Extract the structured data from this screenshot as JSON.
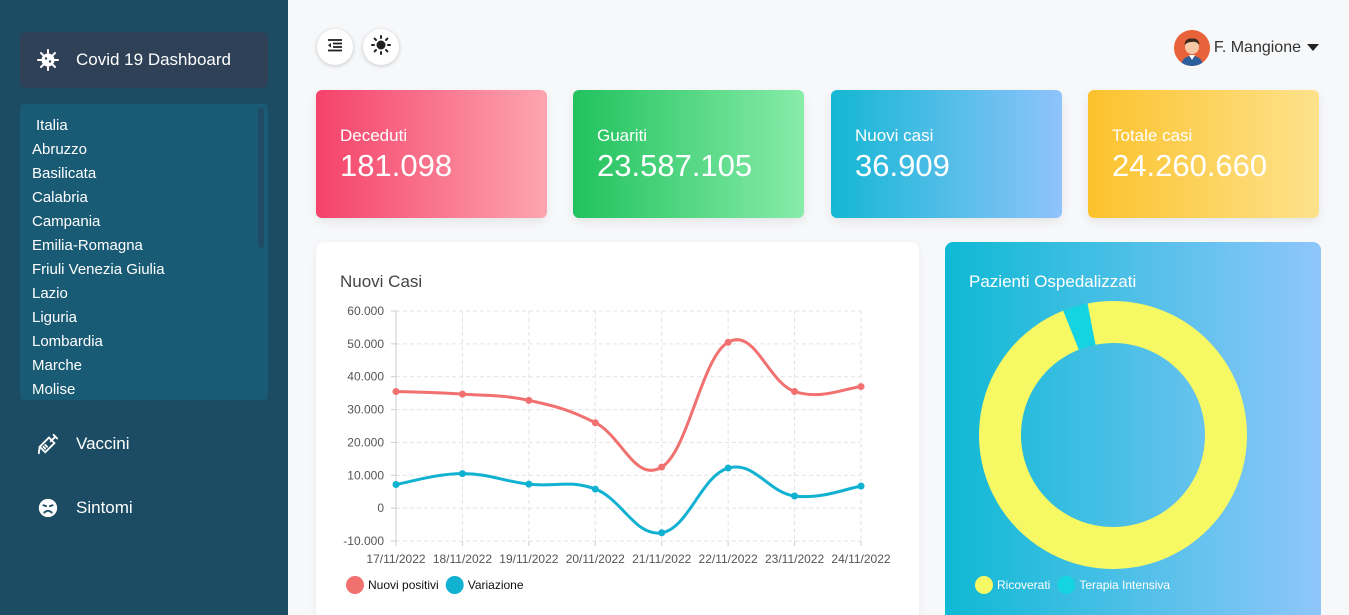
{
  "sidebar": {
    "brand": "Covid 19 Dashboard",
    "regions": [
      "Italia",
      "Abruzzo",
      "Basilicata",
      "Calabria",
      "Campania",
      "Emilia-Romagna",
      "Friuli Venezia Giulia",
      "Lazio",
      "Liguria",
      "Lombardia",
      "Marche",
      "Molise"
    ],
    "nav": {
      "vaccini": "Vaccini",
      "sintomi": "Sintomi"
    }
  },
  "user": {
    "name": "F. Mangione"
  },
  "stats": {
    "deceduti": {
      "label": "Deceduti",
      "value": "181.098"
    },
    "guariti": {
      "label": "Guariti",
      "value": "23.587.105"
    },
    "nuovi": {
      "label": "Nuovi casi",
      "value": "36.909"
    },
    "totale": {
      "label": "Totale casi",
      "value": "24.260.660"
    }
  },
  "panels": {
    "line_title": "Nuovi Casi",
    "donut_title": "Pazienti Ospedalizzati"
  },
  "colors": {
    "positivi": "#f0716f",
    "variazione": "#11b1d1",
    "ricoverati": "#f6f864",
    "terapia": "#14d4e2"
  },
  "chart_data": [
    {
      "type": "line",
      "categories": [
        "17/11/2022",
        "18/11/2022",
        "19/11/2022",
        "20/11/2022",
        "21/11/2022",
        "22/11/2022",
        "23/11/2022",
        "24/11/2022"
      ],
      "series": [
        {
          "name": "Nuovi positivi",
          "values": [
            35500,
            34700,
            32800,
            26000,
            12500,
            50500,
            35500,
            37000
          ]
        },
        {
          "name": "Variazione",
          "values": [
            7200,
            10500,
            7300,
            5800,
            -7500,
            12200,
            3700,
            6700
          ]
        }
      ],
      "ylim": [
        -10000,
        60000
      ],
      "yticks": [
        "60.000",
        "50.000",
        "40.000",
        "30.000",
        "20.000",
        "10.000",
        "0",
        "-10.000"
      ],
      "legend": "bottom-left",
      "grid": true
    },
    {
      "type": "pie",
      "categories": [
        "Ricoverati",
        "Terapia Intensiva"
      ],
      "values": [
        97,
        3
      ],
      "legend": "bottom-left"
    }
  ]
}
